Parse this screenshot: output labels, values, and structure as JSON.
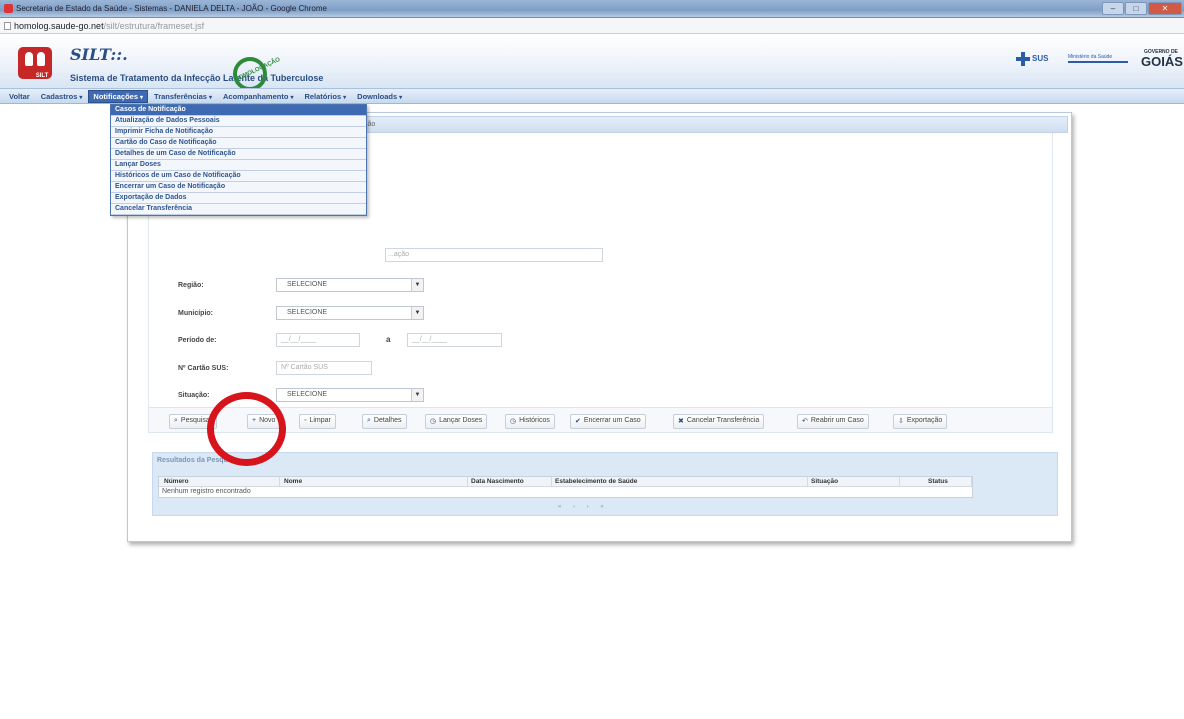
{
  "window": {
    "title": "Secretaria de Estado da Saúde - Sistemas - DANIELA DELTA - JOÃO - Google Chrome"
  },
  "address_bar": {
    "host": "homolog.saude-go.net",
    "path": "/silt/estrutura/frameset.jsf"
  },
  "banner": {
    "logo_text": "SILT",
    "system_name": "SILT::.",
    "system_subtitle": "Sistema de Tratamento da Infecção Latente da Tuberculose",
    "homolog_stamp": "HOMOLOGAÇÃO",
    "sus_label": "SUS",
    "ministry": "Ministério da Saúde",
    "goias_small": "GOVERNO DE",
    "goias": "GOIÁS"
  },
  "menubar": {
    "items": [
      {
        "label": "Voltar",
        "active": false
      },
      {
        "label": "Cadastros",
        "active": false
      },
      {
        "label": "Notificações",
        "active": true
      },
      {
        "label": "Transferências",
        "active": false
      },
      {
        "label": "Acompanhamento",
        "active": false
      },
      {
        "label": "Relatórios",
        "active": false
      },
      {
        "label": "Downloads",
        "active": false
      }
    ]
  },
  "dropdown": {
    "items": [
      "Casos de Notificação",
      "Atualização de Dados Pessoais",
      "Imprimir Ficha de Notificação",
      "Cartão do Caso de Notificação",
      "Detalhes de um Caso de Notificação",
      "Lançar Doses",
      "Históricos de um Caso de Notificação",
      "Encerrar um Caso de Notificação",
      "Exportação de Dados",
      "Cancelar Transferência"
    ]
  },
  "panel": {
    "header_text": "ção",
    "search_placeholder": "...ação"
  },
  "form": {
    "regiao_label": "Região:",
    "regiao_value": "SELECIONE",
    "municipio_label": "Município:",
    "municipio_value": "SELECIONE",
    "periodo_label": "Período de:",
    "periodo_from_placeholder": "__/__/____",
    "periodo_sep": "a",
    "periodo_to_placeholder": "__/__/____",
    "cartao_label": "Nº Cartão SUS:",
    "cartao_placeholder": "Nº Cartão SUS",
    "situacao_label": "Situação:",
    "situacao_value": "SELECIONE"
  },
  "actions": [
    {
      "label": "Pesquisar",
      "icon": "search-icon",
      "glyph": "⌕"
    },
    {
      "label": "Novo",
      "icon": "plus-icon",
      "glyph": "+"
    },
    {
      "label": "Limpar",
      "icon": "eraser-icon",
      "glyph": "◦"
    },
    {
      "label": "Detalhes",
      "icon": "details-icon",
      "glyph": "⌕"
    },
    {
      "label": "Lançar Doses",
      "icon": "doses-icon",
      "glyph": "◷"
    },
    {
      "label": "Históricos",
      "icon": "history-icon",
      "glyph": "◷"
    },
    {
      "label": "Encerrar um Caso",
      "icon": "check-icon",
      "glyph": "✔"
    },
    {
      "label": "Cancelar Transferência",
      "icon": "cancel-icon",
      "glyph": "✖"
    },
    {
      "label": "Reabrir um Caso",
      "icon": "reopen-icon",
      "glyph": "↶"
    },
    {
      "label": "Exportação",
      "icon": "export-icon",
      "glyph": "⇩"
    }
  ],
  "results": {
    "title": "Resultados da Pesquisa",
    "columns": [
      "Número",
      "Nome",
      "Data Nascimento",
      "Estabelecimento de Saúde",
      "Situação",
      "Status"
    ],
    "empty_message": "Nenhum registro encontrado",
    "pager": "« ‹ › »"
  }
}
